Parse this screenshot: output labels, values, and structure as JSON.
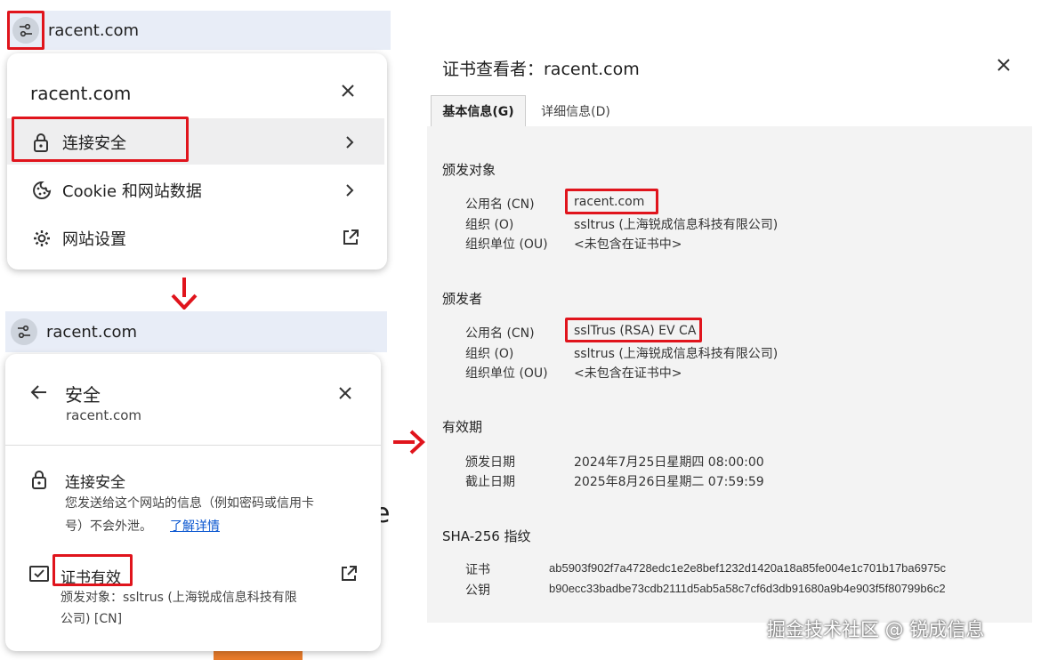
{
  "top_bar": {
    "domain": "racent.com"
  },
  "site_popup": {
    "title": "racent.com",
    "items": [
      {
        "label": "连接安全",
        "icon": "lock-icon"
      },
      {
        "label": "Cookie 和网站数据",
        "icon": "cookie-icon"
      },
      {
        "label": "网站设置",
        "icon": "gear-icon"
      }
    ]
  },
  "second_bar": {
    "domain": "racent.com"
  },
  "security_popup": {
    "title": "安全",
    "subtitle": "racent.com",
    "connection_title": "连接安全",
    "connection_desc_1": "您发送给这个网站的信息（例如密码或信用卡",
    "connection_desc_2": "号）不会外泄。",
    "learn_more": "了解详情",
    "cert_title": "证书有效",
    "cert_desc_1": "颁发对象：ssltrus (上海锐成信息科技有限",
    "cert_desc_2": "公司) [CN]",
    "bg_glyph": "e"
  },
  "cert_viewer": {
    "title": "证书查看者：racent.com",
    "tabs": [
      "基本信息(G)",
      "详细信息(D)"
    ],
    "issued_to": {
      "heading": "颁发对象",
      "cn_label": "公用名 (CN)",
      "cn": "racent.com",
      "o_label": "组织 (O)",
      "o": "ssltrus (上海锐成信息科技有限公司)",
      "ou_label": "组织单位 (OU)",
      "ou": "<未包含在证书中>"
    },
    "issued_by": {
      "heading": "颁发者",
      "cn_label": "公用名 (CN)",
      "cn": "sslTrus (RSA) EV CA",
      "o_label": "组织 (O)",
      "o": "ssltrus (上海锐成信息科技有限公司)",
      "ou_label": "组织单位 (OU)",
      "ou": "<未包含在证书中>"
    },
    "validity": {
      "heading": "有效期",
      "issued_label": "颁发日期",
      "issued": "2024年7月25日星期四 08:00:00",
      "expires_label": "截止日期",
      "expires": "2025年8月26日星期二 07:59:59"
    },
    "fingerprints": {
      "heading": "SHA-256 指纹",
      "cert_label": "证书",
      "cert": "ab5903f902f7a4728edc1e2e8bef1232d1420a18a85fe004e1c701b17ba6975c",
      "key_label": "公钥",
      "key": "b90ecc33badbe73cdb2111d5ab5a58c7cf6d3db91680a9b4e903f5f80799b6c2"
    }
  },
  "watermark": "掘金技术社区 @ 锐成信息",
  "colors": {
    "highlight": "#e0141c",
    "link": "#0b57d0",
    "bar": "#e8edf7"
  }
}
